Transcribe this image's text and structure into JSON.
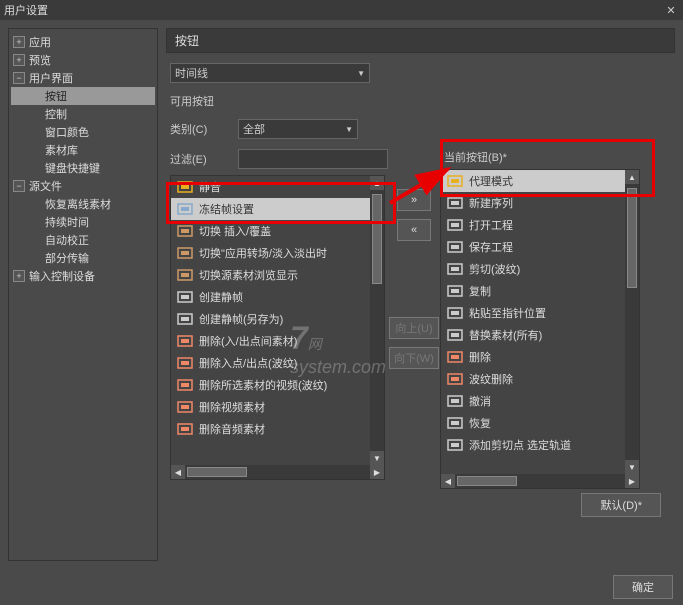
{
  "titlebar": {
    "title": "用户设置"
  },
  "sidebar": {
    "items": [
      {
        "label": "应用",
        "expander": "+",
        "level": 0
      },
      {
        "label": "预览",
        "expander": "+",
        "level": 0
      },
      {
        "label": "用户界面",
        "expander": "−",
        "level": 0
      },
      {
        "label": "按钮",
        "level": 1,
        "selected": true
      },
      {
        "label": "控制",
        "level": 1
      },
      {
        "label": "窗口颜色",
        "level": 1
      },
      {
        "label": "素材库",
        "level": 1
      },
      {
        "label": "键盘快捷键",
        "level": 1
      },
      {
        "label": "源文件",
        "expander": "−",
        "level": 0
      },
      {
        "label": "恢复离线素材",
        "level": 1
      },
      {
        "label": "持续时间",
        "level": 1
      },
      {
        "label": "自动校正",
        "level": 1
      },
      {
        "label": "部分传输",
        "level": 1
      },
      {
        "label": "输入控制设备",
        "expander": "+",
        "level": 0
      }
    ]
  },
  "main": {
    "header": "按钮",
    "dropdown1_label": "时间线",
    "avail_label": "可用按钮",
    "category_label": "类别(C)",
    "category_value": "全部",
    "filter_label": "过滤(E)",
    "filter_value": ""
  },
  "left_list": [
    {
      "label": "静音",
      "icon": "mute"
    },
    {
      "label": "冻结帧设置",
      "icon": "freeze",
      "selected": true
    },
    {
      "label": "切换 插入/覆盖",
      "icon": "toggle"
    },
    {
      "label": "切换\"应用转场/淡入淡出时",
      "icon": "transition"
    },
    {
      "label": "切换源素材浏览显示",
      "icon": "browse"
    },
    {
      "label": "创建静帧",
      "icon": "camera"
    },
    {
      "label": "创建静帧(另存为)",
      "icon": "camera-save"
    },
    {
      "label": "删除(入/出点间素材)",
      "icon": "delete"
    },
    {
      "label": "删除入点/出点(波纹)",
      "icon": "delete-ripple"
    },
    {
      "label": "删除所选素材的视频(波纹)",
      "icon": "delete-video"
    },
    {
      "label": "删除视频素材",
      "icon": "delete-v"
    },
    {
      "label": "删除音频素材",
      "icon": "delete-a"
    }
  ],
  "right": {
    "label": "当前按钮(B)*",
    "items": [
      {
        "label": "代理模式",
        "icon": "pen",
        "selected": true
      },
      {
        "label": "新建序列",
        "icon": "new"
      },
      {
        "label": "打开工程",
        "icon": "open"
      },
      {
        "label": "保存工程",
        "icon": "save"
      },
      {
        "label": "剪切(波纹)",
        "icon": "cut"
      },
      {
        "label": "复制",
        "icon": "copy"
      },
      {
        "label": "粘贴至指针位置",
        "icon": "paste"
      },
      {
        "label": "替换素材(所有)",
        "icon": "replace"
      },
      {
        "label": "删除",
        "icon": "del"
      },
      {
        "label": "波纹删除",
        "icon": "ripple-del"
      },
      {
        "label": "撤消",
        "icon": "undo"
      },
      {
        "label": "恢复",
        "icon": "redo"
      },
      {
        "label": "添加剪切点 选定轨道",
        "icon": "add-cut"
      }
    ]
  },
  "mid_buttons": {
    "add": "»",
    "remove": "«",
    "up": "向上(U)",
    "down": "向下(W)"
  },
  "footer": {
    "default": "默认(D)*",
    "ok": "确定"
  },
  "watermark": {
    "num": "7",
    "text": "system.com"
  }
}
